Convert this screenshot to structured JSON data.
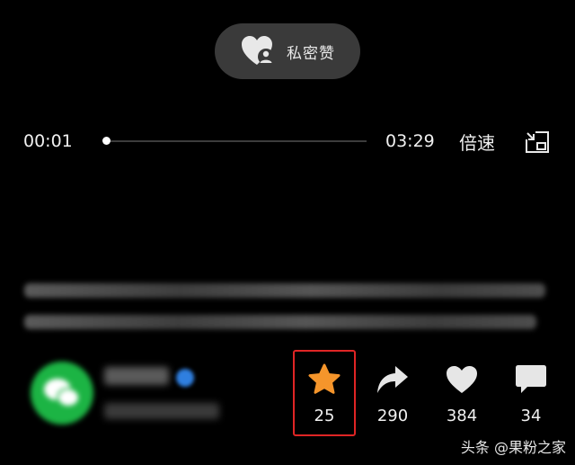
{
  "toast": {
    "label": "私密赞",
    "icon": "private-like-heart-icon"
  },
  "player": {
    "current_time": "00:01",
    "total_time": "03:29",
    "progress": 0.0048,
    "speed_label": "倍速",
    "pip_icon": "picture-in-picture-icon"
  },
  "author": {
    "avatar_icon": "wechat-logo-icon",
    "verified_icon": "verified-badge-icon"
  },
  "actions": {
    "favorite": {
      "icon": "star-icon",
      "count": "25",
      "color": "#f5952b"
    },
    "share": {
      "icon": "share-arrow-icon",
      "count": "290"
    },
    "like": {
      "icon": "heart-icon",
      "count": "384"
    },
    "comment": {
      "icon": "comment-bubble-icon",
      "count": "34"
    }
  },
  "highlight_color": "#e02525",
  "watermark": "头条 @果粉之家"
}
